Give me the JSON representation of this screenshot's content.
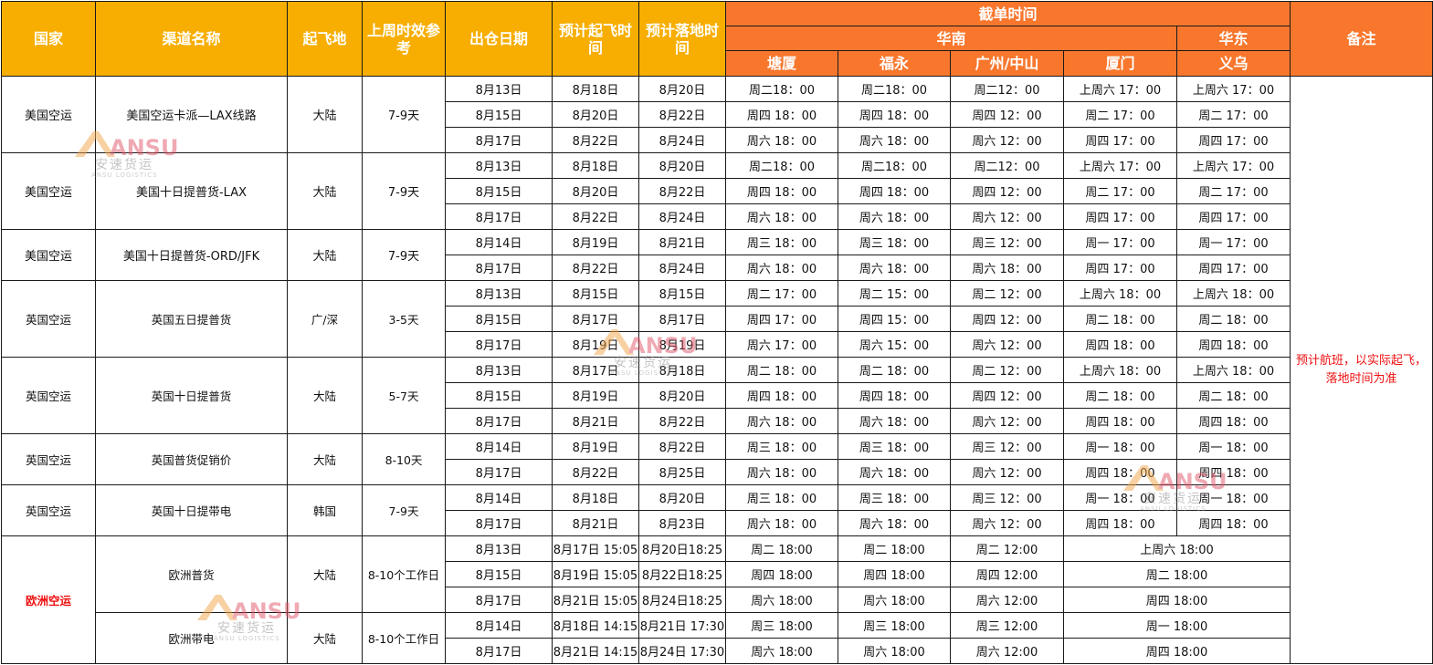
{
  "header": {
    "country": "国家",
    "channel": "渠道名称",
    "origin": "起飞地",
    "last_week_transit": "上周时效参考",
    "warehouse_date": "出仓日期",
    "est_departure": "预计起飞时间",
    "est_arrival": "预计落地时间",
    "cutoff": "截单时间",
    "region_south": "华南",
    "region_east": "华东",
    "remark": "备注",
    "cities": [
      "塘厦",
      "福永",
      "广州/中山",
      "厦门",
      "义乌"
    ]
  },
  "remark_text": "预计航班，以实际起飞，落地时间为准",
  "watermark": {
    "brand": "ANSU",
    "cn": "安速货运",
    "en": "ANSU LOGISTICS"
  },
  "colors": {
    "header_yellow": "#f7ae00",
    "header_orange": "#f8772d",
    "remark_red": "#e11111"
  },
  "groups": [
    {
      "country": "美国空运",
      "channel": "美国空运卡派—LAX线路",
      "origin": "大陆",
      "transit": "7-9天",
      "rows": [
        {
          "date": "8月13日",
          "dep": "8月18日",
          "arr": "8月20日",
          "cut": [
            "周二18：00",
            "周二18：00",
            "周二12：00",
            "上周六 17：00",
            "上周六 17：00"
          ]
        },
        {
          "date": "8月15日",
          "dep": "8月20日",
          "arr": "8月22日",
          "cut": [
            "周四 18：00",
            "周四 18：00",
            "周四 12：00",
            "周二 17：00",
            "周二 17：00"
          ]
        },
        {
          "date": "8月17日",
          "dep": "8月22日",
          "arr": "8月24日",
          "cut": [
            "周六 18：00",
            "周六 18：00",
            "周六 12：00",
            "周四 17：00",
            "周四 17：00"
          ]
        }
      ]
    },
    {
      "country": "美国空运",
      "channel": "美国十日提普货-LAX",
      "origin": "大陆",
      "transit": "7-9天",
      "rows": [
        {
          "date": "8月13日",
          "dep": "8月18日",
          "arr": "8月20日",
          "cut": [
            "周二18：00",
            "周二18：00",
            "周二12：00",
            "上周六 17：00",
            "上周六 17：00"
          ]
        },
        {
          "date": "8月15日",
          "dep": "8月20日",
          "arr": "8月22日",
          "cut": [
            "周四 18：00",
            "周四 18：00",
            "周四 12：00",
            "周二 17：00",
            "周二 17：00"
          ]
        },
        {
          "date": "8月17日",
          "dep": "8月22日",
          "arr": "8月24日",
          "cut": [
            "周六 18：00",
            "周六 18：00",
            "周六 12：00",
            "周四 17：00",
            "周四 17：00"
          ]
        }
      ]
    },
    {
      "country": "美国空运",
      "channel": "美国十日提普货-ORD/JFK",
      "origin": "大陆",
      "transit": "7-9天",
      "rows": [
        {
          "date": "8月14日",
          "dep": "8月19日",
          "arr": "8月21日",
          "cut": [
            "周三 18：00",
            "周三 18：00",
            "周三 12：00",
            "周一 17：00",
            "周一 17：00"
          ]
        },
        {
          "date": "8月17日",
          "dep": "8月22日",
          "arr": "8月24日",
          "cut": [
            "周六 18：00",
            "周六 18：00",
            "周六 18：00",
            "周四 17：00",
            "周四 17：00"
          ]
        }
      ]
    },
    {
      "country": "英国空运",
      "channel": "英国五日提普货",
      "origin": "广/深",
      "transit": "3-5天",
      "small": true,
      "rows": [
        {
          "date": "8月13日",
          "dep": "8月15日",
          "arr": "8月15日",
          "cut": [
            "周二 17：00",
            "周二 15：00",
            "周二 12：00",
            "上周六 18：00",
            "上周六 18：00"
          ]
        },
        {
          "date": "8月15日",
          "dep": "8月17日",
          "arr": "8月17日",
          "cut": [
            "周四 17：00",
            "周四 15：00",
            "周四 12：00",
            "周二 18：00",
            "周二 18：00"
          ]
        },
        {
          "date": "8月17日",
          "dep": "8月19日",
          "arr": "8月19日",
          "cut": [
            "周六 17：00",
            "周六 15：00",
            "周六 12：00",
            "周四 18：00",
            "周四 18：00"
          ]
        }
      ]
    },
    {
      "country": "英国空运",
      "channel": "英国十日提普货",
      "origin": "大陆",
      "transit": "5-7天",
      "small": true,
      "rows": [
        {
          "date": "8月13日",
          "dep": "8月17日",
          "arr": "8月18日",
          "cut": [
            "周二 18：00",
            "周二 18：00",
            "周二 12：00",
            "上周六 18：00",
            "上周六 18：00"
          ]
        },
        {
          "date": "8月15日",
          "dep": "8月19日",
          "arr": "8月20日",
          "cut": [
            "周四 18：00",
            "周四 18：00",
            "周四 12：00",
            "周二 18：00",
            "周二 18：00"
          ]
        },
        {
          "date": "8月17日",
          "dep": "8月21日",
          "arr": "8月22日",
          "cut": [
            "周六 18：00",
            "周六 18：00",
            "周六 12：00",
            "周四 18：00",
            "周四 18：00"
          ]
        }
      ]
    },
    {
      "country": "英国空运",
      "channel": "英国普货促销价",
      "origin": "大陆",
      "transit": "8-10天",
      "small": true,
      "rows": [
        {
          "date": "8月14日",
          "dep": "8月19日",
          "arr": "8月22日",
          "cut": [
            "周三 18：00",
            "周三 18：00",
            "周三 12：00",
            "周一 18：00",
            "周一 18：00"
          ]
        },
        {
          "date": "8月17日",
          "dep": "8月22日",
          "arr": "8月25日",
          "cut": [
            "周六 18：00",
            "周六 18：00",
            "周六 12：00",
            "周四 18：00",
            "周四 18：00"
          ]
        }
      ]
    },
    {
      "country": "英国空运",
      "channel": "英国十日提带电",
      "origin": "韩国",
      "transit": "7-9天",
      "small": true,
      "rows": [
        {
          "date": "8月14日",
          "dep": "8月18日",
          "arr": "8月20日",
          "cut": [
            "周三 18：00",
            "周三 18：00",
            "周三 12：00",
            "周一 18：00",
            "周一 18：00"
          ]
        },
        {
          "date": "8月17日",
          "dep": "8月21日",
          "arr": "8月23日",
          "cut": [
            "周六 18：00",
            "周六 18：00",
            "周六 12：00",
            "周四 18：00",
            "周四 18：00"
          ]
        }
      ]
    },
    {
      "country": "欧洲空运",
      "channel": "欧洲普货",
      "origin": "大陆",
      "transit": "8-10个工作日",
      "small": true,
      "red_country": true,
      "country_span": 5,
      "merge_xm_yw": true,
      "rows": [
        {
          "date": "8月13日",
          "dep": "8月17日 15:05",
          "arr": "8月20日18:25",
          "cut": [
            "周二 18:00",
            "周二 18:00",
            "周二 12:00",
            "上周六 18:00"
          ]
        },
        {
          "date": "8月15日",
          "dep": "8月19日 15:05",
          "arr": "8月22日18:25",
          "cut": [
            "周四 18:00",
            "周四 18:00",
            "周四 12:00",
            "周二 18:00"
          ]
        },
        {
          "date": "8月17日",
          "dep": "8月21日 15:05",
          "arr": "8月24日18:25",
          "cut": [
            "周六 18:00",
            "周六 18:00",
            "周六 12:00",
            "周四 18:00"
          ]
        }
      ]
    },
    {
      "channel": "欧洲带电",
      "origin": "大陆",
      "transit": "8-10个工作日",
      "small": true,
      "no_country": true,
      "merge_xm_yw": true,
      "rows": [
        {
          "date": "8月14日",
          "dep": "8月18日 14:15",
          "arr": "8月21日 17:30",
          "cut": [
            "周三 18:00",
            "周三 18:00",
            "周三 12:00",
            "周一 18:00"
          ]
        },
        {
          "date": "8月17日",
          "dep": "8月21日 14:15",
          "arr": "8月24日 17:30",
          "cut": [
            "周六 18:00",
            "周六 18:00",
            "周六 12:00",
            "周四 18:00"
          ]
        }
      ]
    }
  ]
}
